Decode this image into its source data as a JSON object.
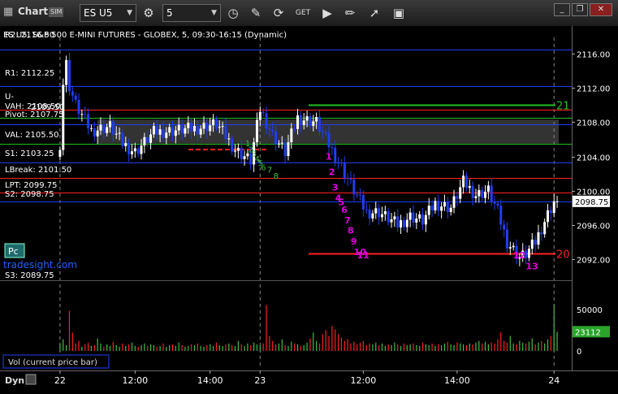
{
  "toolbar": {
    "window_title": "Chart",
    "sim_badge": "SIM",
    "symbol": "ES U5",
    "interval": "5",
    "icons": [
      "chart-icon",
      "settings-gear-icon",
      "clock-icon",
      "pencil-draw-icon",
      "refresh-icon",
      "get-data-icon",
      "play-icon",
      "ruler-icon",
      "export-icon",
      "window-menu-icon",
      "minimize-icon",
      "restore-icon",
      "close-icon"
    ]
  },
  "chart_header": {
    "title": "ES U5, S&P 500 E-MINI FUTURES - GLOBEX, 5, 09:30-16:15 (Dynamic)"
  },
  "left_panel": {
    "pc_button": "Pc",
    "watermark": "tradesight.com",
    "volume_label": "Vol (current price bar)",
    "dyn_label": "Dyn"
  },
  "colors": {
    "up_bar": "#ffffff",
    "down_bar": "#1f3df2",
    "pivot_line": "#1f3df2",
    "resistance_line": "#ff2020",
    "vah_line": "#20c020",
    "countdown_sell": "#e000e0",
    "countdown_buy": "#40c040",
    "volume_up": "#40c040",
    "volume_down": "#ff2020"
  },
  "chart_data": [
    {
      "type": "candlestick",
      "title": "ES U5, S&P 500 E-MINI FUTURES - GLOBEX, 5, 09:30-16:15 (Dynamic)",
      "x_tick_labels": [
        "22",
        "12:00",
        "14:00",
        "23",
        "12:00",
        "14:00",
        "24"
      ],
      "y_ticks": [
        2092.0,
        2096.0,
        2100.0,
        2104.0,
        2108.0,
        2112.0,
        2116.0
      ],
      "ylim": [
        2090.2,
        2117.9
      ],
      "last_price": "2098.75",
      "price_path": [
        [
          0,
          2105.5
        ],
        [
          1,
          2112.5
        ],
        [
          2,
          2114.8
        ],
        [
          3,
          2112.2
        ],
        [
          5,
          2110.0
        ],
        [
          10,
          2107.0
        ],
        [
          16,
          2107.5
        ],
        [
          20,
          2105.5
        ],
        [
          24,
          2104.5
        ],
        [
          30,
          2106.8
        ],
        [
          36,
          2107.0
        ],
        [
          44,
          2107.3
        ],
        [
          50,
          2107.8
        ],
        [
          56,
          2104.8
        ],
        [
          61,
          2103.5
        ],
        [
          64,
          2109.5
        ],
        [
          68,
          2106.5
        ],
        [
          72,
          2104.5
        ],
        [
          76,
          2108.5
        ],
        [
          82,
          2108.0
        ],
        [
          85,
          2106.0
        ],
        [
          90,
          2102.8
        ],
        [
          94,
          2100.0
        ],
        [
          98,
          2097.5
        ],
        [
          102,
          2097.5
        ],
        [
          108,
          2096.0
        ],
        [
          112,
          2097.0
        ],
        [
          116,
          2096.5
        ],
        [
          120,
          2098.5
        ],
        [
          125,
          2098.0
        ],
        [
          129,
          2101.0
        ],
        [
          133,
          2099.5
        ],
        [
          137,
          2100.0
        ],
        [
          140,
          2097.5
        ],
        [
          143,
          2094.0
        ],
        [
          147,
          2092.2
        ],
        [
          149,
          2092.6
        ],
        [
          152,
          2094.0
        ],
        [
          155,
          2096.5
        ],
        [
          158,
          2098.75
        ]
      ],
      "levels": [
        {
          "label": "R2: 2116.50",
          "value": 2116.5,
          "color": "#1f3df2"
        },
        {
          "label": "R1: 2112.25",
          "value": 2112.25,
          "color": "#1f3df2"
        },
        {
          "label": "U-",
          "value": 2109.5,
          "color": "#ff2020"
        },
        {
          "label": "2109.50",
          "value": 2109.5,
          "color": "#ff2020"
        },
        {
          "label": "VAH: 2108.50",
          "value": 2108.5,
          "color": "#20c020"
        },
        {
          "label": "Pivot: 2107.75",
          "value": 2107.75,
          "color": "#1f3df2"
        },
        {
          "label": "VAL: 2105.50",
          "value": 2105.5,
          "color": "#20c020"
        },
        {
          "label": "S1: 2103.25",
          "value": 2103.25,
          "color": "#1f3df2"
        },
        {
          "label": "LBreak: 2101.50",
          "value": 2101.5,
          "color": "#ff2020"
        },
        {
          "label": "LPT: 2099.75",
          "value": 2099.75,
          "color": "#ff2020"
        },
        {
          "label": "S2: 2098.75",
          "value": 2098.75,
          "color": "#1f3df2"
        },
        {
          "label": "S3: 2089.75",
          "value": 2089.75,
          "color": "#1f3df2"
        }
      ],
      "right_markers": [
        {
          "label": "21",
          "value": 2110.0,
          "color": "#20c020"
        },
        {
          "label": "20",
          "value": 2092.7,
          "color": "#ff2020"
        }
      ],
      "sell_countdown": {
        "color": "#e000e0",
        "labels": [
          "1",
          "2",
          "3",
          "4",
          "5",
          "6",
          "7",
          "8",
          "9",
          "10",
          "11",
          "12",
          "13"
        ],
        "positions": [
          [
            86,
            2103.6
          ],
          [
            87,
            2101.8
          ],
          [
            88,
            2100.0
          ],
          [
            89,
            2098.8
          ],
          [
            90,
            2098.3
          ],
          [
            91,
            2097.4
          ],
          [
            92,
            2096.2
          ],
          [
            93,
            2095.0
          ],
          [
            94,
            2093.7
          ],
          [
            95,
            2092.5
          ],
          [
            96,
            2092.1
          ],
          [
            146,
            2092.1
          ],
          [
            150,
            2090.8
          ]
        ]
      },
      "buy_setup": {
        "color": "#40c040",
        "labels": [
          "1",
          "2",
          "3",
          "4",
          "5",
          "6",
          "7",
          "8"
        ],
        "positions": [
          [
            60,
            2105.2
          ],
          [
            61,
            2104.5
          ],
          [
            62,
            2104.0
          ],
          [
            63,
            2103.4
          ],
          [
            64,
            2102.9
          ],
          [
            65,
            2102.4
          ],
          [
            67,
            2102.1
          ],
          [
            69,
            2101.4
          ]
        ]
      },
      "volume": {
        "y_ticks": [
          "50000",
          "0"
        ],
        "ylim": [
          0,
          80000
        ],
        "last_value": "23112",
        "values": [
          9000,
          14000,
          7000,
          48000,
          22000,
          9000,
          12000,
          5000,
          8000,
          10000,
          6000,
          7000,
          15000,
          9000,
          5000,
          8000,
          6000,
          11000,
          7000,
          5000,
          9000,
          6000,
          8000,
          10000,
          6000,
          5000,
          7000,
          9000,
          6000,
          8000,
          7000,
          5000,
          6000,
          9000,
          5000,
          7000,
          8000,
          6000,
          10000,
          7000,
          5000,
          6000,
          8000,
          7000,
          9000,
          6000,
          5000,
          7000,
          8000,
          6000,
          10000,
          7000,
          6000,
          8000,
          9000,
          7000,
          6000,
          12000,
          8000,
          6000,
          9000,
          7000,
          10000,
          8000,
          7000,
          9000,
          55000,
          18000,
          12000,
          8000,
          9000,
          14000,
          7000,
          6000,
          11000,
          9000,
          8000,
          6000,
          7000,
          10000,
          15000,
          22000,
          12000,
          9000,
          20000,
          25000,
          18000,
          30000,
          26000,
          20000,
          16000,
          12000,
          14000,
          9000,
          11000,
          8000,
          10000,
          12000,
          7000,
          9000,
          8000,
          10000,
          7000,
          9000,
          6000,
          8000,
          7000,
          10000,
          8000,
          6000,
          9000,
          7000,
          8000,
          9000,
          7000,
          6000,
          10000,
          8000,
          7000,
          9000,
          6000,
          8000,
          7000,
          9000,
          11000,
          8000,
          7000,
          10000,
          9000,
          8000,
          7000,
          9000,
          8000,
          10000,
          12000,
          9000,
          11000,
          8000,
          10000,
          9000,
          14000,
          22000,
          12000,
          10000,
          18000,
          9000,
          8000,
          12000,
          10000,
          9000,
          11000,
          15000,
          8000,
          10000,
          12000,
          9000,
          14000,
          18000,
          55000,
          23112
        ]
      }
    }
  ]
}
